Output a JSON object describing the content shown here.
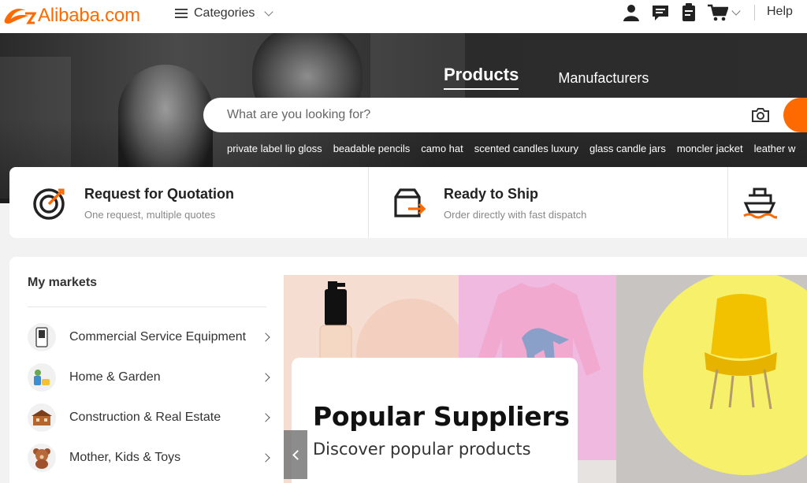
{
  "header": {
    "logo_text": "Alibaba.com",
    "categories_label": "Categories",
    "help_label": "Help",
    "brand_color": "#ff6a00"
  },
  "hero": {
    "tabs": [
      {
        "label": "Products",
        "active": true
      },
      {
        "label": "Manufacturers",
        "active": false
      }
    ],
    "search": {
      "placeholder": "What are you looking for?"
    },
    "trending": [
      "private label lip gloss",
      "beadable pencils",
      "camo hat",
      "scented candles luxury",
      "glass candle jars",
      "moncler jacket",
      "leather w"
    ]
  },
  "services": [
    {
      "title": "Request for Quotation",
      "subtitle": "One request, multiple quotes",
      "icon": "target-icon"
    },
    {
      "title": "Ready to Ship",
      "subtitle": "Order directly with fast dispatch",
      "icon": "shipping-box-icon"
    },
    {
      "title": "",
      "subtitle": "",
      "icon": "ship-icon"
    }
  ],
  "markets": {
    "title": "My markets",
    "items": [
      {
        "label": "Commercial Service Equipment"
      },
      {
        "label": "Home & Garden"
      },
      {
        "label": "Construction & Real Estate"
      },
      {
        "label": "Mother, Kids & Toys"
      }
    ]
  },
  "banner": {
    "title": "Popular Suppliers",
    "subtitle": "Discover popular products"
  }
}
